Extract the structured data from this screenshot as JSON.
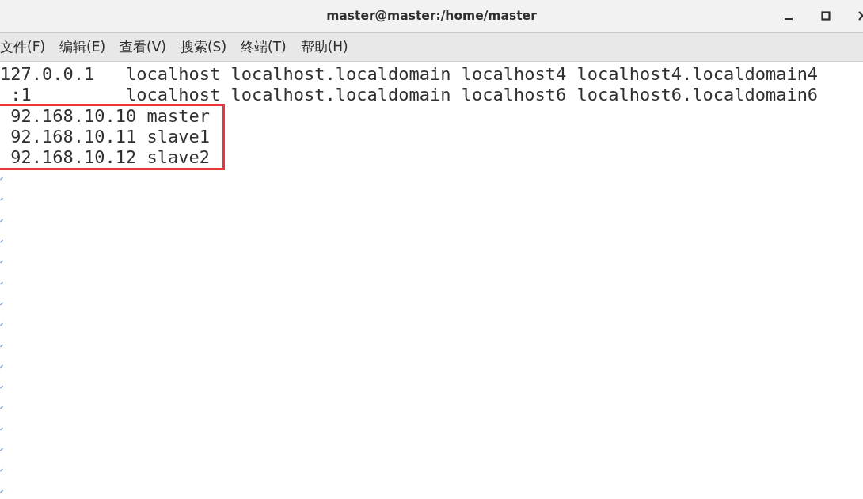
{
  "window": {
    "title": "master@master:/home/master"
  },
  "menu": [
    {
      "label": "文件(F)"
    },
    {
      "label": "编辑(E)"
    },
    {
      "label": "查看(V)"
    },
    {
      "label": "搜索(S)"
    },
    {
      "label": "终端(T)"
    },
    {
      "label": "帮助(H)"
    }
  ],
  "lines": [
    {
      "text": "127.0.0.1   localhost localhost.localdomain localhost4 localhost4.localdomain4",
      "highlighted": false
    },
    {
      "text": " :1         localhost localhost.localdomain localhost6 localhost6.localdomain6",
      "highlighted": false
    },
    {
      "text": " 92.168.10.10 master",
      "highlighted": true
    },
    {
      "text": " 92.168.10.11 slave1",
      "highlighted": true
    },
    {
      "text": " 92.168.10.12 slave2",
      "highlighted": true
    }
  ]
}
